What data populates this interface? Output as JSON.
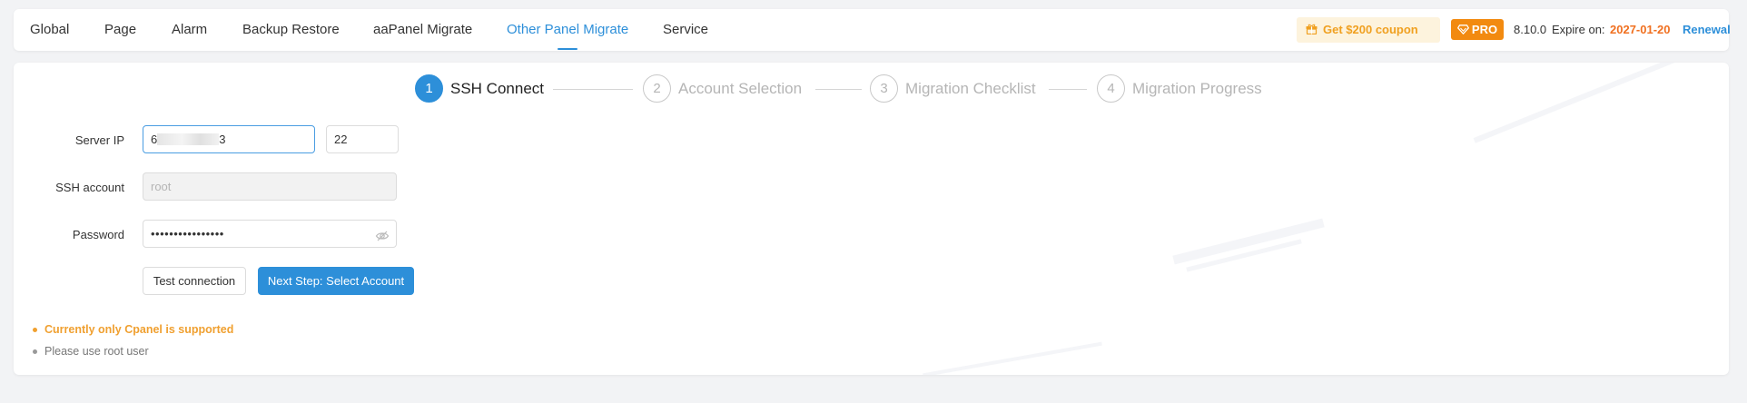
{
  "tabs": [
    {
      "label": "Global"
    },
    {
      "label": "Page"
    },
    {
      "label": "Alarm"
    },
    {
      "label": "Backup Restore"
    },
    {
      "label": "aaPanel Migrate"
    },
    {
      "label": "Other Panel Migrate",
      "active": true
    },
    {
      "label": "Service"
    }
  ],
  "header": {
    "coupon_label": "Get $200 coupon",
    "pro_label": "PRO",
    "version": "8.10.0",
    "expire_label": "Expire on:",
    "expire_date": "2027-01-20",
    "renewal_label": "Renewal"
  },
  "steps": [
    {
      "num": "1",
      "label": "SSH Connect",
      "active": true
    },
    {
      "num": "2",
      "label": "Account Selection"
    },
    {
      "num": "3",
      "label": "Migration Checklist"
    },
    {
      "num": "4",
      "label": "Migration Progress"
    }
  ],
  "form": {
    "server_ip_label": "Server IP",
    "server_ip_prefix": "6",
    "server_ip_suffix": "3",
    "port_value": "22",
    "ssh_account_label": "SSH account",
    "ssh_account_value": "root",
    "password_label": "Password",
    "password_value": "••••••••••••••••"
  },
  "buttons": {
    "test": "Test connection",
    "next": "Next Step: Select Account"
  },
  "notes": [
    {
      "text": "Currently only Cpanel is supported",
      "type": "warn"
    },
    {
      "text": "Please use root user",
      "type": "info"
    }
  ],
  "colors": {
    "accent": "#2d8fd9",
    "warning": "#f0a030",
    "pro": "#f28a10",
    "expire": "#f07020"
  }
}
